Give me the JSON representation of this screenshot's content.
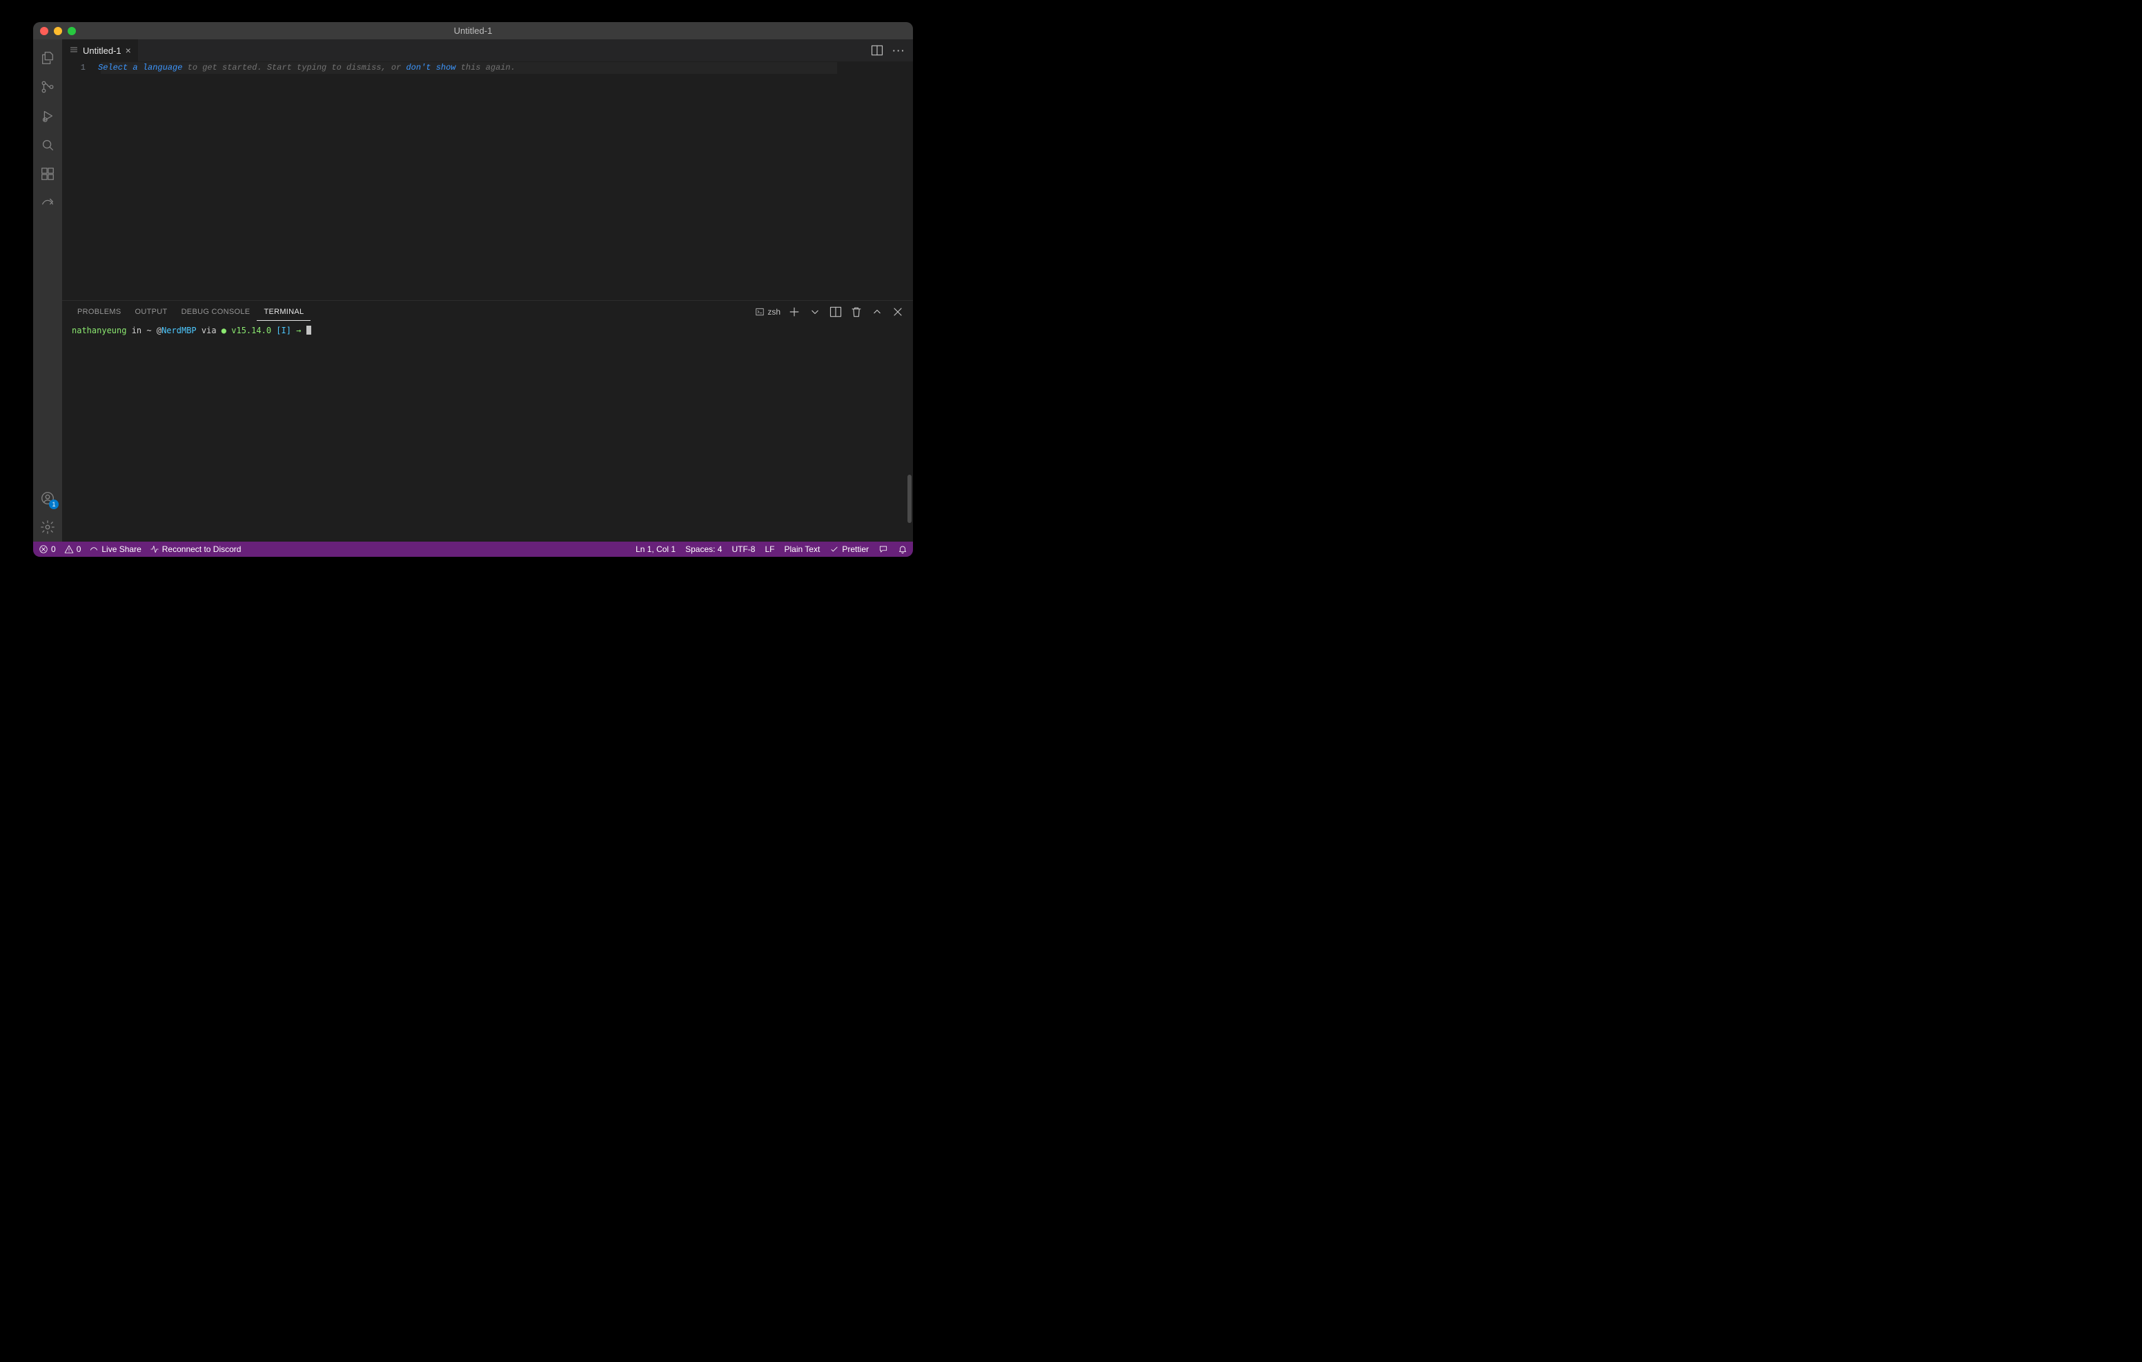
{
  "window": {
    "title": "Untitled-1"
  },
  "tab": {
    "label": "Untitled-1"
  },
  "editor": {
    "line_number": "1",
    "hint_link1": "Select a language",
    "hint_mid": " to get started. Start typing to dismiss, or ",
    "hint_link2": "don't show",
    "hint_end": " this again."
  },
  "panel": {
    "tabs": {
      "problems": "PROBLEMS",
      "output": "OUTPUT",
      "debug": "DEBUG CONSOLE",
      "terminal": "TERMINAL"
    },
    "shell_label": "zsh"
  },
  "terminal": {
    "user": "nathanyeung",
    "in": " in ",
    "path": "~ ",
    "at": "@",
    "host": "NerdMBP",
    "via": " via ",
    "bullet": "●",
    "version": " v15.14.0 ",
    "mode": "[I]",
    "arrow": " → "
  },
  "status": {
    "errors": "0",
    "warnings": "0",
    "liveshare": "Live Share",
    "reconnect": "Reconnect to Discord",
    "lncol": "Ln 1, Col 1",
    "spaces": "Spaces: 4",
    "encoding": "UTF-8",
    "eol": "LF",
    "lang": "Plain Text",
    "prettier": "Prettier"
  },
  "account_badge": "1"
}
